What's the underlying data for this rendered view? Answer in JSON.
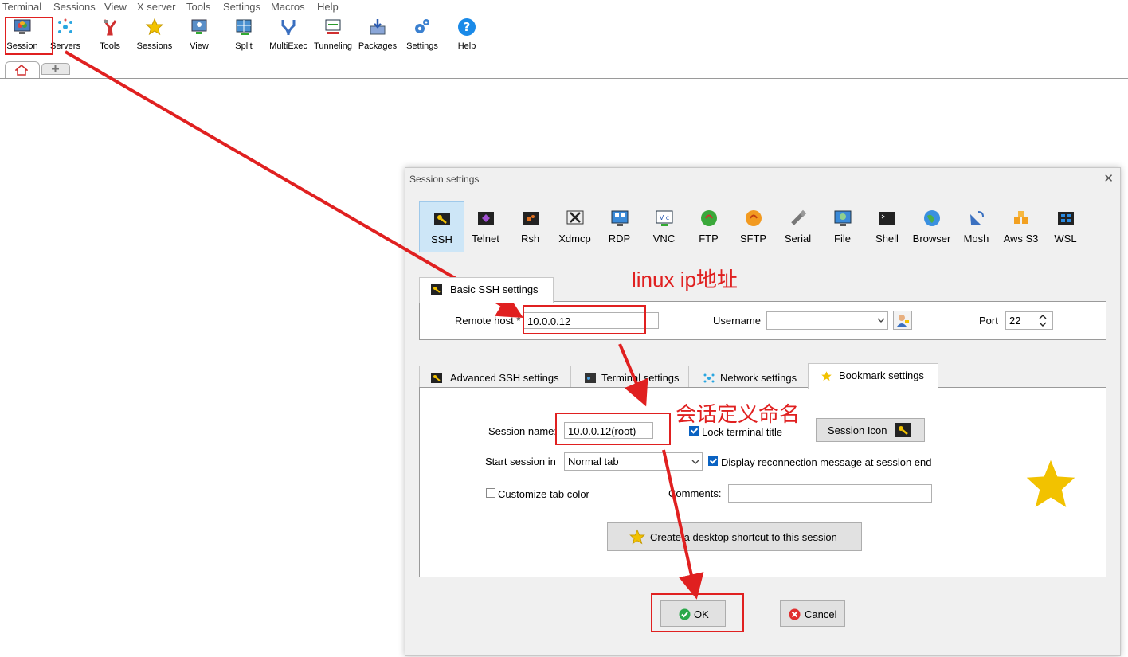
{
  "menubar": [
    "Terminal",
    "Sessions",
    "View",
    "X server",
    "Tools",
    "Settings",
    "Macros",
    "Help"
  ],
  "toolbar": [
    {
      "label": "Session",
      "icon": "session-icon"
    },
    {
      "label": "Servers",
      "icon": "servers-icon"
    },
    {
      "label": "Tools",
      "icon": "tools-icon"
    },
    {
      "label": "Sessions",
      "icon": "star-icon"
    },
    {
      "label": "View",
      "icon": "view-icon"
    },
    {
      "label": "Split",
      "icon": "split-icon"
    },
    {
      "label": "MultiExec",
      "icon": "multiexec-icon"
    },
    {
      "label": "Tunneling",
      "icon": "tunneling-icon"
    },
    {
      "label": "Packages",
      "icon": "packages-icon"
    },
    {
      "label": "Settings",
      "icon": "gear-icon"
    },
    {
      "label": "Help",
      "icon": "help-icon"
    }
  ],
  "dialog": {
    "title": "Session settings",
    "close_glyph": "✕",
    "protocols": [
      "SSH",
      "Telnet",
      "Rsh",
      "Xdmcp",
      "RDP",
      "VNC",
      "FTP",
      "SFTP",
      "Serial",
      "File",
      "Shell",
      "Browser",
      "Mosh",
      "Aws S3",
      "WSL"
    ],
    "selected_protocol": "SSH",
    "basic_tab": "Basic SSH settings",
    "remote_host_label": "Remote host *",
    "remote_host_value": "10.0.0.12",
    "username_label": "Username",
    "username_value": "",
    "port_label": "Port",
    "port_value": "22",
    "lower_tabs": [
      "Advanced SSH settings",
      "Terminal settings",
      "Network settings",
      "Bookmark settings"
    ],
    "active_lower_tab": "Bookmark settings",
    "session_name_label": "Session name:",
    "session_name_value": "10.0.0.12(root)",
    "lock_terminal_title": "Lock terminal title",
    "session_icon_button": "Session Icon",
    "start_session_label": "Start session in",
    "start_session_value": "Normal tab",
    "display_reconnection": "Display reconnection message at session end",
    "customize_tab_color": "Customize tab color",
    "comments_label": "Comments:",
    "comments_value": "",
    "shortcut_button": "Create a desktop shortcut to this session",
    "ok_button": "OK",
    "cancel_button": "Cancel"
  },
  "annotations": {
    "remote_host_note": "linux ip地址",
    "session_name_note": "会话定义命名"
  },
  "colors": {
    "annotation_red": "#e02020",
    "selected_protocol_bg": "#cde6f7",
    "bookmark_star": "#f2c200",
    "checkbox_blue": "#0a62c2"
  }
}
